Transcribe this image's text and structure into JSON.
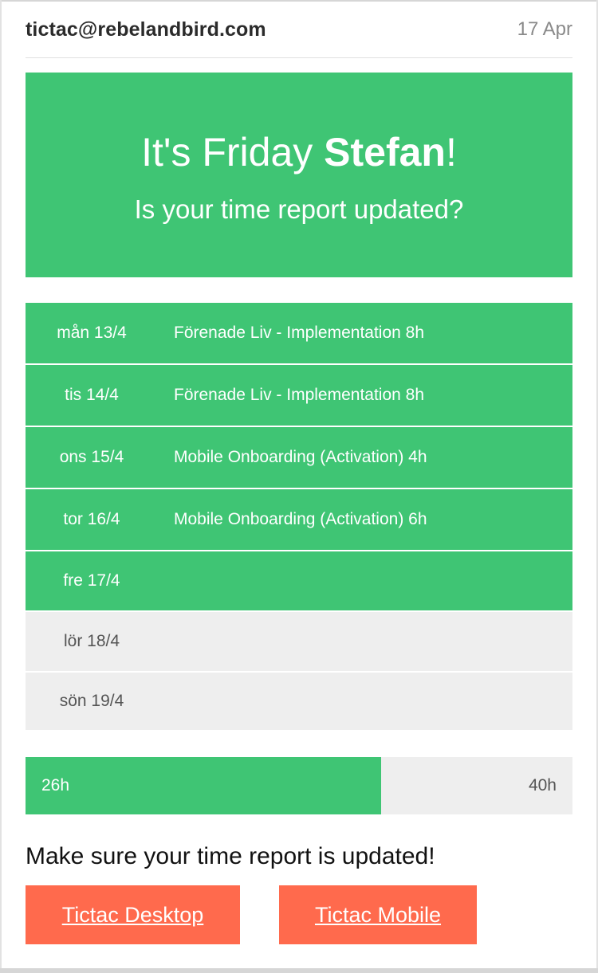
{
  "mail": {
    "sender": "tictac@rebelandbird.com",
    "date": "17 Apr"
  },
  "hero": {
    "title_prefix": "It's Friday ",
    "title_name": "Stefan",
    "title_suffix": "!",
    "subtitle": "Is your time report updated?"
  },
  "days": [
    {
      "label": "mån 13/4",
      "entry": "Förenade Liv - Implementation 8h",
      "status": "active"
    },
    {
      "label": "tis 14/4",
      "entry": "Förenade Liv - Implementation 8h",
      "status": "active"
    },
    {
      "label": "ons 15/4",
      "entry": "Mobile Onboarding (Activation) 4h",
      "status": "active"
    },
    {
      "label": "tor 16/4",
      "entry": "Mobile Onboarding (Activation) 6h",
      "status": "active"
    },
    {
      "label": "fre 17/4",
      "entry": "",
      "status": "active"
    },
    {
      "label": "lör 18/4",
      "entry": "",
      "status": "inactive"
    },
    {
      "label": "sön 19/4",
      "entry": "",
      "status": "inactive"
    }
  ],
  "progress": {
    "current_label": "26h",
    "target_label": "40h",
    "current_hours": 26,
    "target_hours": 40
  },
  "reminder": "Make sure your time report is updated!",
  "buttons": {
    "desktop": "Tictac Desktop",
    "mobile": "Tictac Mobile"
  },
  "colors": {
    "accent_green": "#3fc574",
    "cta_orange": "#ff6a4d",
    "inactive_gray": "#eeeeee"
  }
}
